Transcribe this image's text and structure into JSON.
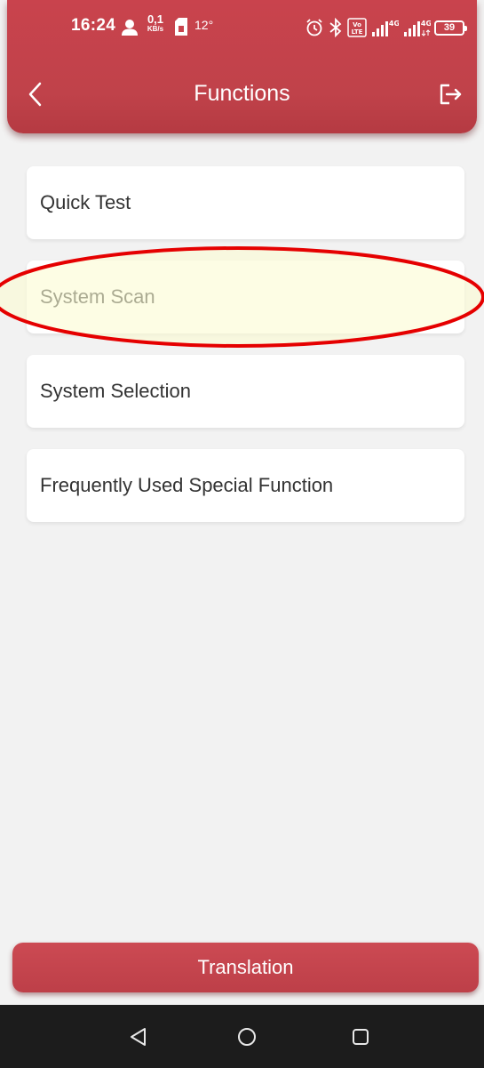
{
  "status_bar": {
    "time": "16:24",
    "net_speed_value": "0,1",
    "net_speed_unit": "KB/s",
    "temperature": "12°",
    "battery_level": "39",
    "network_1": "4G",
    "network_2": "4G",
    "volte": "VoLTE"
  },
  "header": {
    "title": "Functions"
  },
  "menu": {
    "items": [
      {
        "label": "Quick Test"
      },
      {
        "label": "System Scan"
      },
      {
        "label": "System Selection"
      },
      {
        "label": "Frequently Used Special Function"
      }
    ]
  },
  "footer": {
    "translation_label": "Translation"
  },
  "colors": {
    "header_red": "#c9434d",
    "highlight_fill": "#fbfbd2",
    "highlight_stroke": "#e50000",
    "nav_bar_bg": "#1c1c1c"
  },
  "icons": {
    "back": "chevron-left-icon",
    "exit": "logout-icon",
    "user": "user-icon",
    "sim": "sim-card-icon",
    "alarm": "alarm-icon",
    "bluetooth": "bluetooth-icon",
    "volte": "volte-icon",
    "signal": "signal-icon",
    "battery": "battery-icon",
    "sys_back": "triangle-back-icon",
    "sys_home": "circle-home-icon",
    "sys_recents": "square-recents-icon"
  }
}
